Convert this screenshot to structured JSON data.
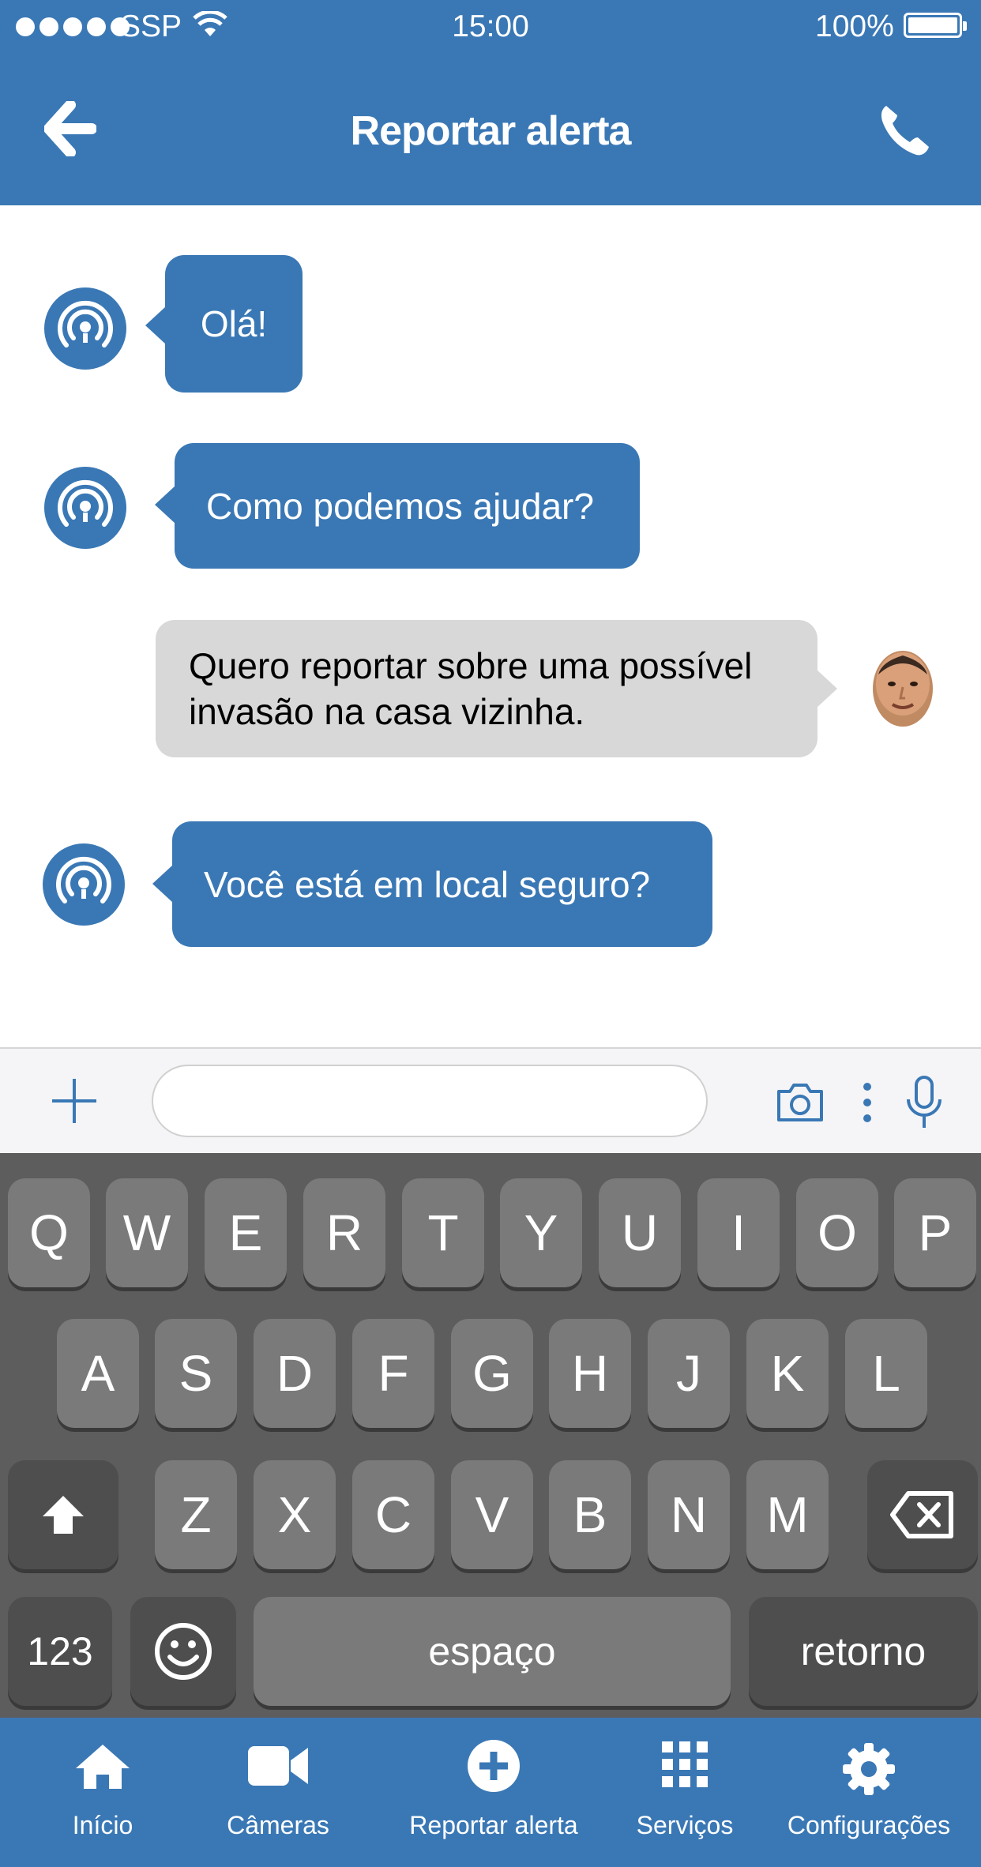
{
  "status_bar": {
    "carrier": "SSP",
    "time": "15:00",
    "battery_percent": "100%"
  },
  "header": {
    "title": "Reportar alerta",
    "back_icon": "arrow-left-icon",
    "call_icon": "phone-icon"
  },
  "chat": {
    "messages": [
      {
        "sender": "bot",
        "text": "Olá!"
      },
      {
        "sender": "bot",
        "text": "Como podemos ajudar?"
      },
      {
        "sender": "user",
        "text_line1": "Quero reportar sobre uma possível",
        "text_line2": "invasão na casa vizinha."
      },
      {
        "sender": "bot",
        "text": "Você está em local seguro?"
      }
    ]
  },
  "input_bar": {
    "placeholder": "",
    "add_icon": "plus-icon",
    "camera_icon": "camera-icon",
    "more_icon": "more-vertical-icon",
    "mic_icon": "microphone-icon"
  },
  "keyboard": {
    "row1": [
      "Q",
      "W",
      "E",
      "R",
      "T",
      "Y",
      "U",
      "I",
      "O",
      "P"
    ],
    "row2": [
      "A",
      "S",
      "D",
      "F",
      "G",
      "H",
      "J",
      "K",
      "L"
    ],
    "row3": [
      "Z",
      "X",
      "C",
      "V",
      "B",
      "N",
      "M"
    ],
    "numbers_key": "123",
    "space_key": "espaço",
    "return_key": "retorno"
  },
  "tab_bar": {
    "items": [
      {
        "label": "Início",
        "icon": "home-icon"
      },
      {
        "label": "Câmeras",
        "icon": "video-camera-icon"
      },
      {
        "label": "Reportar alerta",
        "icon": "plus-circle-icon"
      },
      {
        "label": "Serviços",
        "icon": "grid-icon"
      },
      {
        "label": "Configurações",
        "icon": "gear-icon"
      }
    ]
  },
  "colors": {
    "primary": "#3a78b5",
    "user_bubble": "#d8d8d8",
    "keyboard_bg": "#5d5d5d"
  }
}
